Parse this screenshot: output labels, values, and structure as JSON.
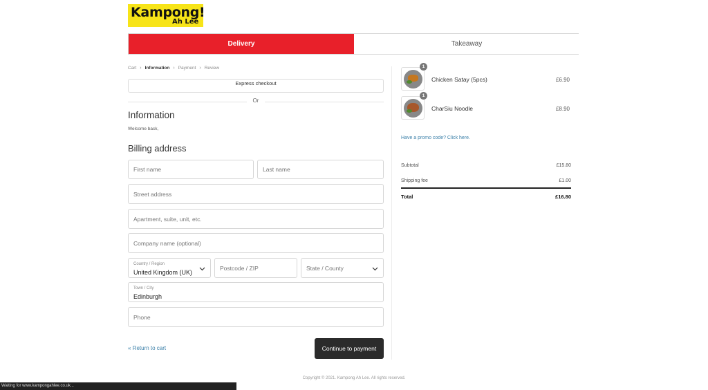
{
  "logo": {
    "line1": "Kampong!",
    "line2": "Ah Lee",
    "bg_color": "#f7e418"
  },
  "tabs": [
    {
      "label": "Delivery",
      "active": true
    },
    {
      "label": "Takeaway",
      "active": false
    }
  ],
  "accent_color": "#e8202a",
  "breadcrumb": {
    "items": [
      "Cart",
      "Information",
      "Payment",
      "Review"
    ],
    "current": "Information"
  },
  "express": {
    "label": "Express checkout"
  },
  "or_label": "Or",
  "information": {
    "heading": "Information",
    "welcome": "Welcome back,"
  },
  "billing": {
    "heading": "Billing address",
    "first_name_placeholder": "First name",
    "last_name_placeholder": "Last name",
    "street_placeholder": "Street address",
    "apartment_placeholder": "Apartment, suite, unit, etc.",
    "company_placeholder": "Company name (optional)",
    "country_label": "Country / Region",
    "country_value": "United Kingdom (UK)",
    "postcode_placeholder": "Postcode / ZIP",
    "state_placeholder": "State / County",
    "town_label": "Town / City",
    "town_value": "Edinburgh",
    "phone_placeholder": "Phone"
  },
  "actions": {
    "return_label": "« Return to cart",
    "continue_label": "Continue to payment"
  },
  "order": {
    "items": [
      {
        "name": "Chicken Satay (5pcs)",
        "price": "£6.90",
        "qty": "1"
      },
      {
        "name": "CharSiu Noodle",
        "price": "£8.90",
        "qty": "1"
      }
    ],
    "promo": "Have a promo code? Click here.",
    "subtotal_label": "Subtotal",
    "subtotal_value": "£15.80",
    "shipping_label": "Shipping fee",
    "shipping_value": "£1.00",
    "total_label": "Total",
    "total_value": "£16.80"
  },
  "footer": {
    "copyright": "Copyright © 2021. Kampong Ah Lee. All rights reserved."
  },
  "status_bar": {
    "text": "Waiting for www.kampongahlee.co.uk..."
  }
}
